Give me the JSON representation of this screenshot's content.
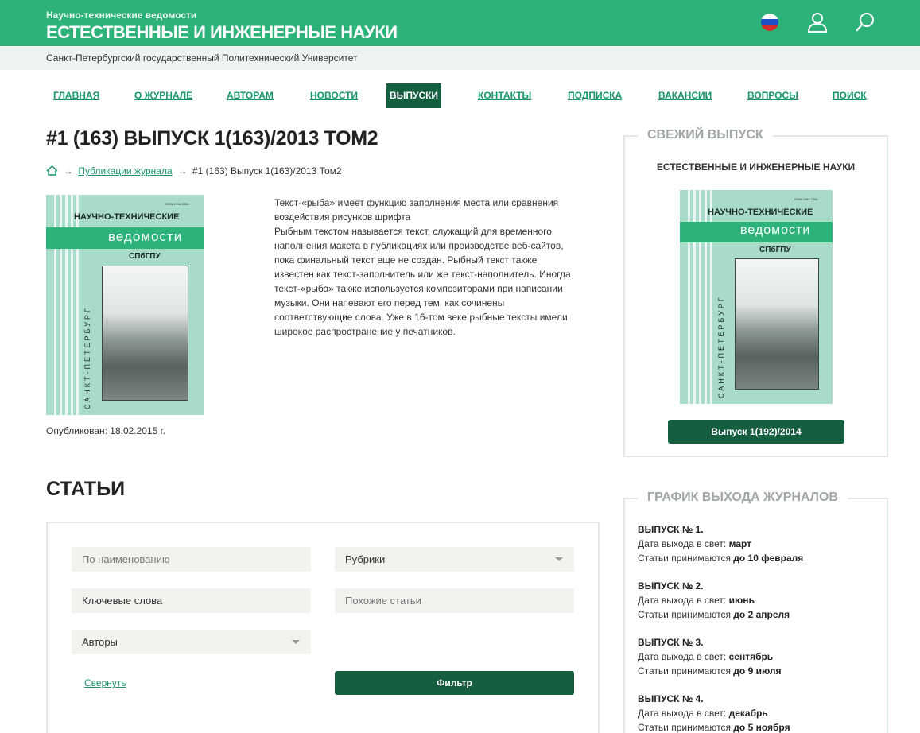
{
  "header": {
    "super_title": "Научно-технические ведомости",
    "title": "ЕСТЕСТВЕННЫЕ И ИНЖЕНЕРНЫЕ НАУКИ",
    "university": "Санкт-Петербургский государственный Политехнический Университет",
    "flag_colors": [
      "#ffffff",
      "#1f4fc7",
      "#d42a2a"
    ]
  },
  "nav": {
    "items": [
      {
        "label": "ГЛАВНАЯ"
      },
      {
        "label": "О ЖУРНАЛЕ"
      },
      {
        "label": "АВТОРАМ"
      },
      {
        "label": "НОВОСТИ"
      },
      {
        "label": "ВЫПУСКИ",
        "active": true
      },
      {
        "label": "КОНТАКТЫ"
      },
      {
        "label": "ПОДПИСКА"
      },
      {
        "label": "ВАКАНСИИ"
      },
      {
        "label": "ВОПРОСЫ"
      },
      {
        "label": "ПОИСК"
      }
    ]
  },
  "issue": {
    "title": "#1 (163) ВЫПУСК 1(163)/2013 ТОМ2",
    "breadcrumb_link": "Публикации журнала",
    "breadcrumb_current": "#1 (163) Выпуск 1(163)/2013 Том2",
    "published": "Опубликован: 18.02.2015 г.",
    "description": [
      "Текст-«рыба» имеет функцию заполнения места или сравнения",
      "воздействия рисунков шрифта",
      "Рыбным текстом называется текст, служащий для временного",
      "наполнения макета в публикациях или производстве веб-сайтов,",
      "пока финальный текст еще не создан. Рыбный текст также",
      "известен как текст-заполнитель или же текст-наполнитель. Иногда",
      "текст-«рыба» также используется композиторами при написании",
      "музыки. Они напевают его перед тем, как сочинены",
      "соответствующие слова. Уже в 16-том веке рыбные тексты имели",
      "широкое распространение у печатников."
    ]
  },
  "cover": {
    "issn": "ISSN 1994-2354",
    "title": "НАУЧНО-ТЕХНИЧЕСКИЕ",
    "band": "ведомости",
    "sub": "СПбГПУ",
    "city": "САНКТ-ПЕТЕРБУРГ"
  },
  "articles": {
    "title": "СТАТЬИ",
    "name_placeholder": "По наименованию",
    "rubrics": "Рубрики",
    "keywords": "Ключевые слова",
    "similar_placeholder": "Похожие статьи",
    "authors": "Авторы",
    "collapse": "Свернуть",
    "filter": "Фильтр"
  },
  "sidebar": {
    "latest_title": "СВЕЖИЙ ВЫПУСК",
    "latest_journal": "ЕСТЕСТВЕННЫЕ И ИНЖЕНЕРНЫЕ НАУКИ",
    "latest_button": "Выпуск 1(192)/2014",
    "schedule_title": "ГРАФИК ВЫХОДА ЖУРНАЛОВ",
    "release_label": "Дата выхода в свет:",
    "accept_label": "Статьи принимаются",
    "schedule": [
      {
        "issue": "ВЫПУСК № 1.",
        "release": "март",
        "deadline": "до 10 февраля"
      },
      {
        "issue": "ВЫПУСК № 2.",
        "release": "июнь",
        "deadline": "до 2 апреля"
      },
      {
        "issue": "ВЫПУСК № 3.",
        "release": "сентябрь",
        "deadline": "до 9 июля"
      },
      {
        "issue": "ВЫПУСК № 4.",
        "release": "декабрь",
        "deadline": "до 5 ноября"
      }
    ]
  }
}
